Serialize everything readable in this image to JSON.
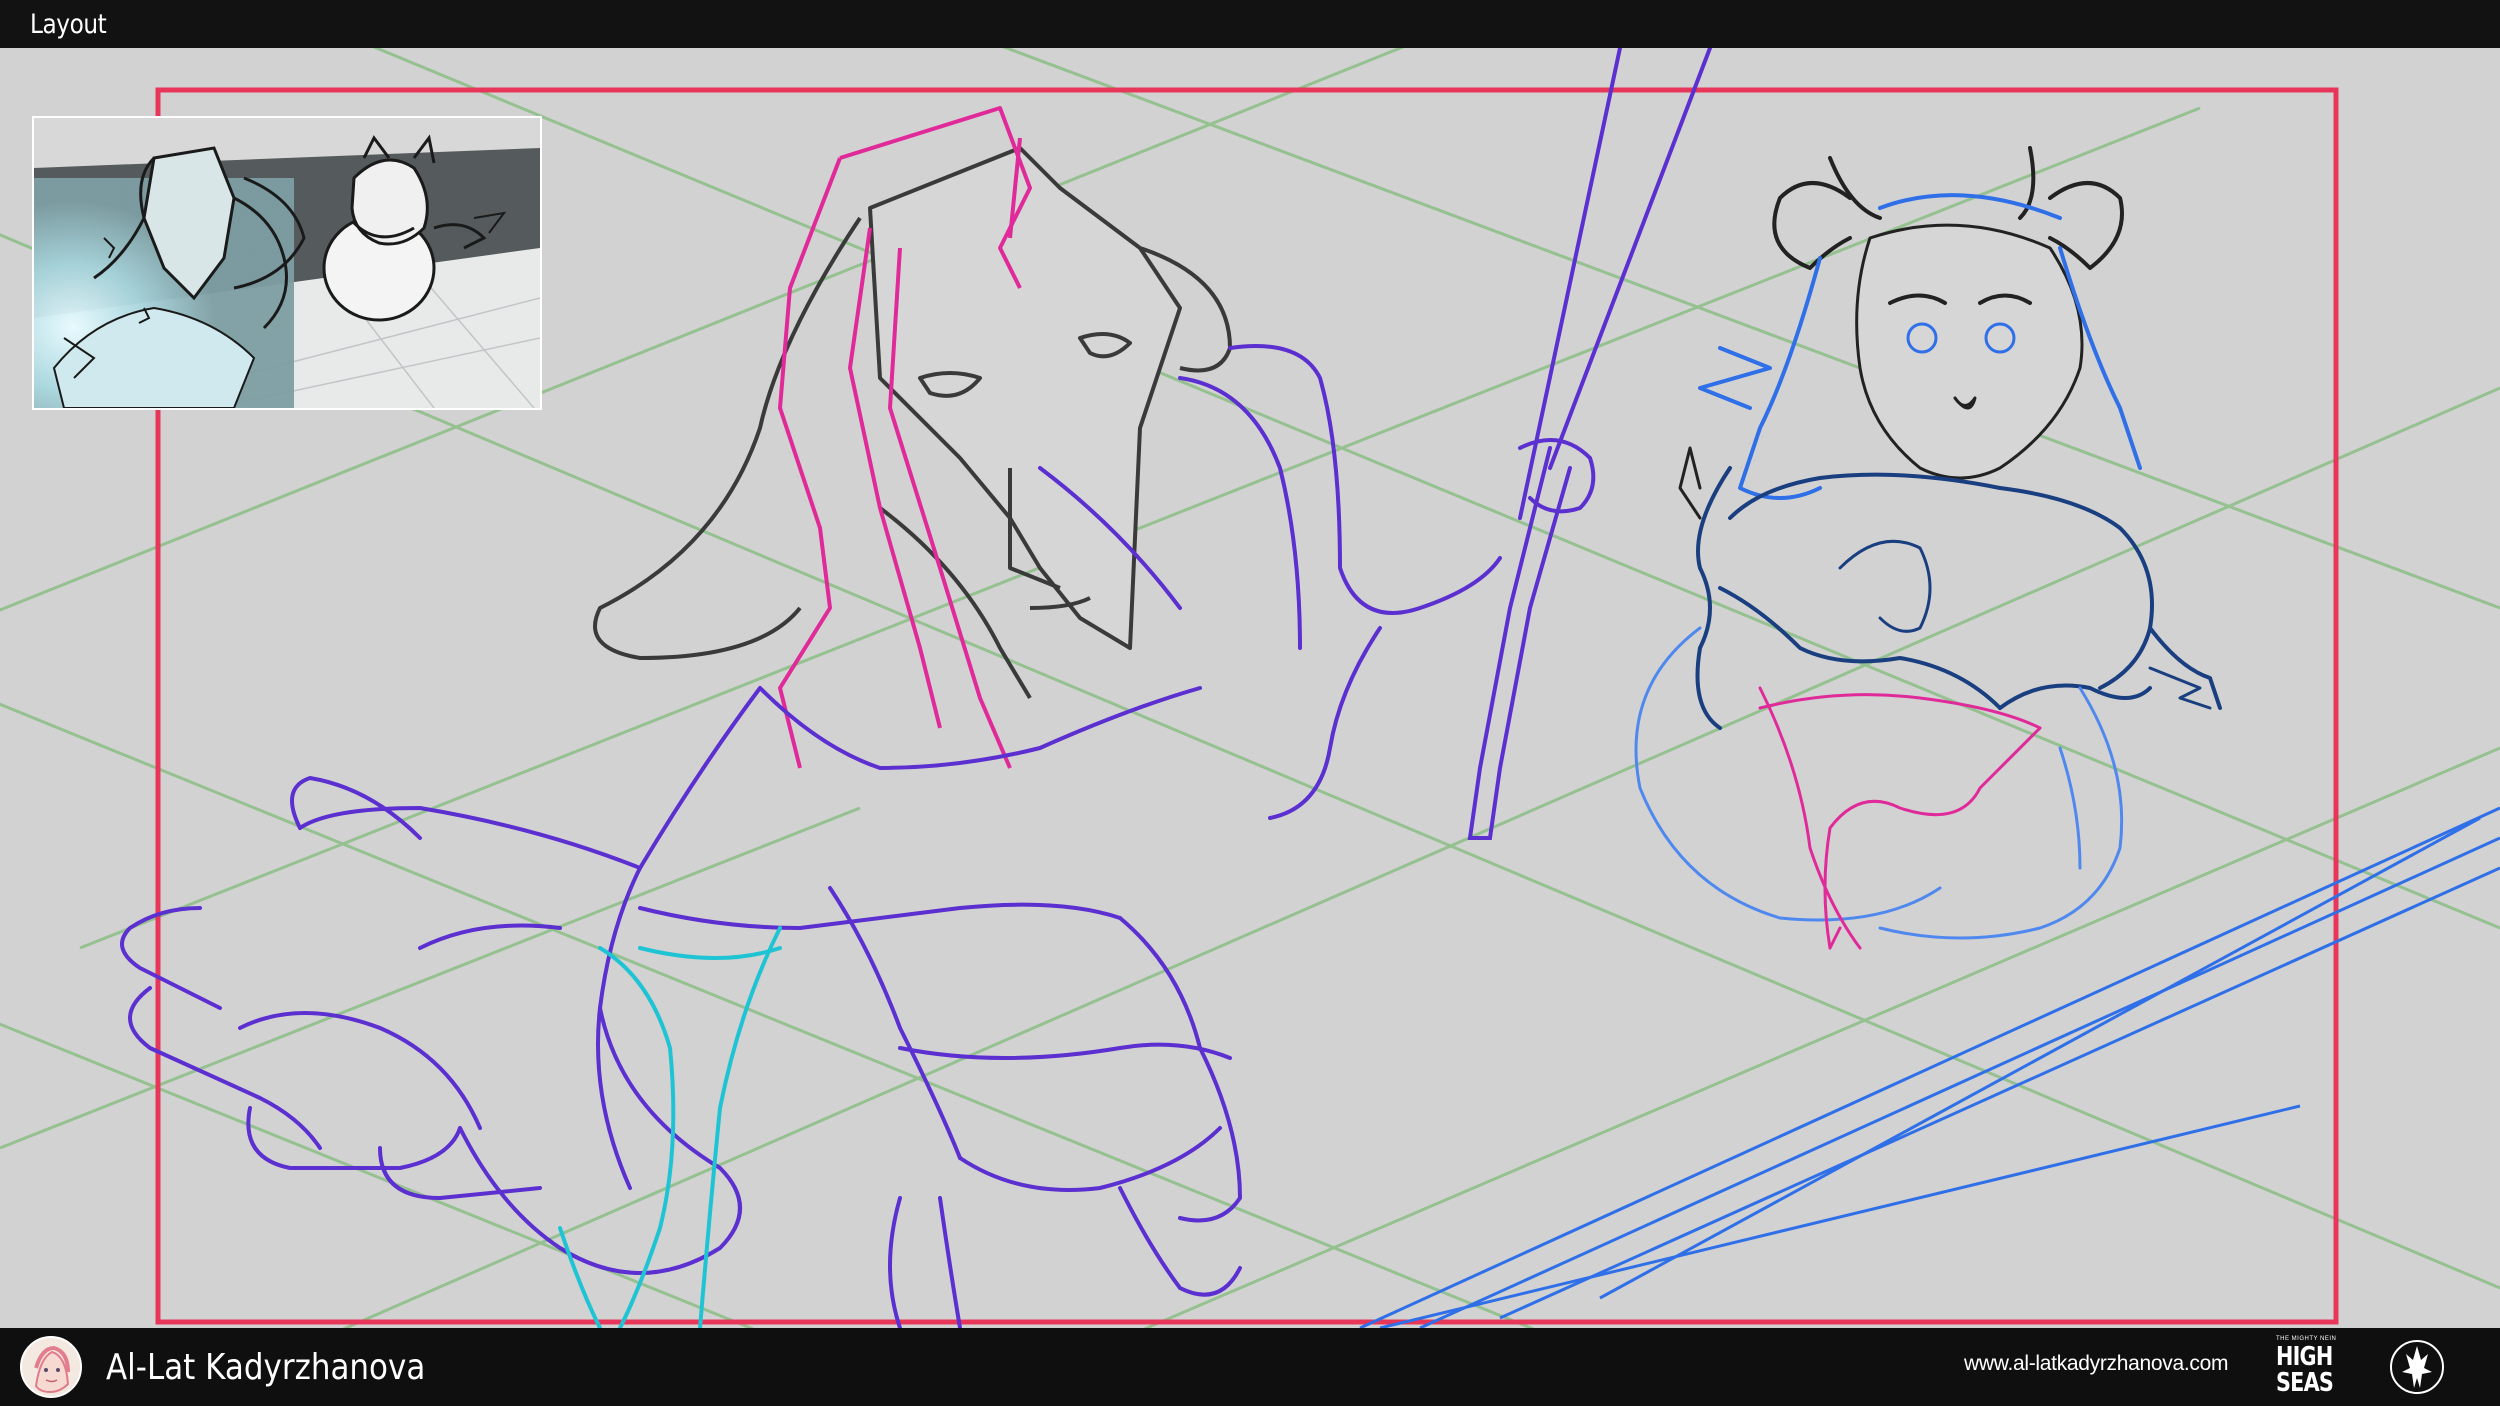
{
  "window": {
    "title": "Layout"
  },
  "footer": {
    "artist_name": "Al-Lat Kadyrzhanova",
    "website": "www.al-latkadyrzhanova.com",
    "logo_small_text": "THE MIGHTY NEIN",
    "logo_line1": "HIGH",
    "logo_line2": "SEAS"
  },
  "colors": {
    "title_bar": "#121212",
    "canvas": "#d2d2d2",
    "frame": "#e8355a",
    "perspective_grid": "#8fc08a",
    "sketch_purple": "#5b2fd0",
    "sketch_magenta": "#e02a9a",
    "sketch_blue": "#2f6fe8",
    "sketch_cyan": "#1fc4d4",
    "sketch_gray": "#3a3a3a",
    "footer": "#0f0f0f"
  },
  "icons": {
    "thumbnail": "reference-thumbnail-image",
    "avatar": "artist-avatar",
    "logo_primary": "high-seas-logo",
    "logo_secondary": "emblem-logo"
  }
}
